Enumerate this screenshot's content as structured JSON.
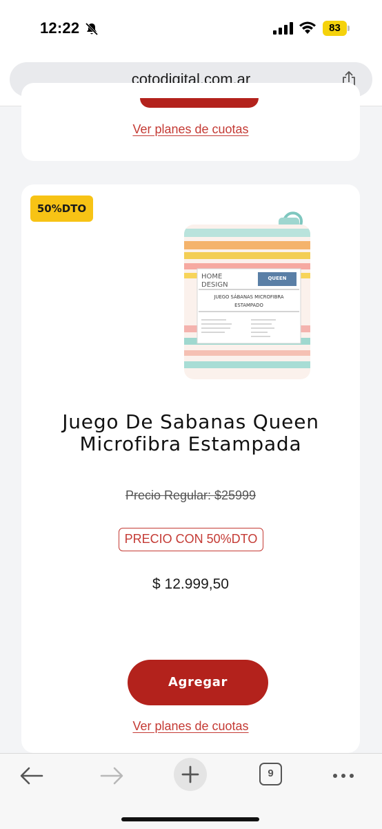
{
  "status_bar": {
    "time": "12:22",
    "battery": "83",
    "battery_color": "#f5d20c"
  },
  "browser": {
    "url": "cotodigital.com.ar",
    "tab_count": "9"
  },
  "cards": [
    {
      "cuotas_link": "Ver planes de cuotas"
    },
    {
      "badge": "50%DTO",
      "product_image": {
        "brand_line1": "HOME",
        "brand_line2": "DESIGN",
        "size_tag": "QUEEN",
        "package_line1": "JUEGO SÁBANAS MICROFIBRA",
        "package_line2": "ESTAMPADO"
      },
      "title": "Juego De Sabanas Queen Microfibra Estampada",
      "regular_price": "Precio Regular: $25999",
      "promo_label": "PRECIO CON 50%DTO",
      "price": "$ 12.999,50",
      "add_button": "Agregar",
      "cuotas_link": "Ver planes de cuotas"
    }
  ],
  "colors": {
    "accent_red": "#b3221c",
    "link_red": "#c43a34",
    "badge_yellow": "#f7c315"
  },
  "toolbar": {
    "icons": [
      "back-arrow-icon",
      "forward-arrow-icon",
      "new-tab-plus-icon",
      "tabs-icon",
      "more-icon"
    ]
  }
}
